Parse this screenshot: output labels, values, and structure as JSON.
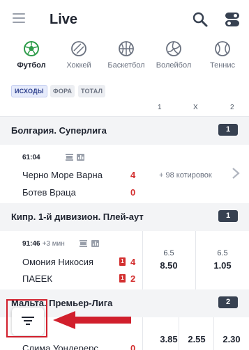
{
  "header": {
    "title": "Live"
  },
  "sports": [
    {
      "label": "Футбол",
      "icon": "soccer-ball-icon",
      "active": true
    },
    {
      "label": "Хоккей",
      "icon": "hockey-puck-icon",
      "active": false
    },
    {
      "label": "Баскетбол",
      "icon": "basketball-icon",
      "active": false
    },
    {
      "label": "Волейбол",
      "icon": "volleyball-icon",
      "active": false
    },
    {
      "label": "Теннис",
      "icon": "tennis-ball-icon",
      "active": false
    }
  ],
  "markets": {
    "tabs": [
      {
        "label": "ИСХОДЫ",
        "active": true
      },
      {
        "label": "ФОРА",
        "active": false
      },
      {
        "label": "ТОТАЛ",
        "active": false
      }
    ],
    "columns": [
      "1",
      "X",
      "2"
    ]
  },
  "leagues": [
    {
      "name": "Болгария. Суперлига",
      "count": "1",
      "matches": [
        {
          "time": "61:04",
          "extra": "",
          "home": "Черно Море Варна",
          "away": "Ботев Враца",
          "home_score": "4",
          "away_score": "0",
          "more_odds": "+ 98 котировок"
        }
      ]
    },
    {
      "name": "Кипр. 1-й дивизион. Плей-аут",
      "count": "1",
      "matches": [
        {
          "time": "91:46",
          "extra": "+3 мин",
          "home": "Омония Никосия",
          "away": "ПАЕЕК",
          "home_score": "4",
          "away_score": "2",
          "home_cards": "1",
          "away_cards": "1",
          "odds": [
            {
              "param": "6.5",
              "value": "8.50"
            },
            {
              "param": "6.5",
              "value": "1.05"
            }
          ]
        }
      ]
    },
    {
      "name": "Мальта. Премьер-Лига",
      "count": "2",
      "matches": [
        {
          "time": "",
          "extra": "",
          "home": "Слима Уондерерс",
          "home_score": "0",
          "odds": [
            {
              "param": "",
              "value": "3.85"
            },
            {
              "param": "",
              "value": "2.55"
            },
            {
              "param": "",
              "value": "2.30"
            }
          ]
        }
      ]
    }
  ],
  "colors": {
    "accent": "#2c3e8c",
    "score": "#d32f2f",
    "highlight": "#d11f2c"
  }
}
